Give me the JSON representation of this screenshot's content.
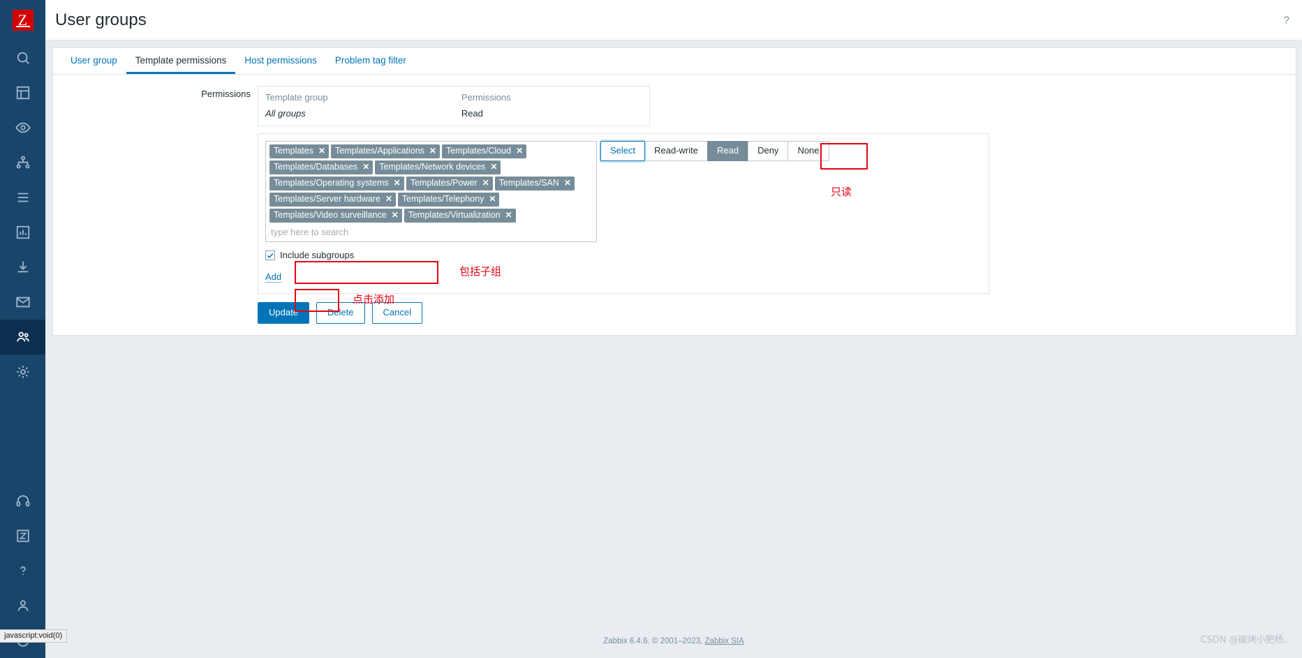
{
  "header": {
    "title": "User groups",
    "help_icon": "?"
  },
  "sidebar": {
    "logo_letter": "Z",
    "items": [
      {
        "name": "search-icon",
        "label": "Search"
      },
      {
        "name": "dashboards-icon",
        "label": "Dashboards"
      },
      {
        "name": "monitoring-icon",
        "label": "Monitoring"
      },
      {
        "name": "services-icon",
        "label": "Services"
      },
      {
        "name": "inventory-icon",
        "label": "Inventory"
      },
      {
        "name": "reports-icon",
        "label": "Reports"
      },
      {
        "name": "data-collection-icon",
        "label": "Data collection"
      },
      {
        "name": "alerts-icon",
        "label": "Alerts"
      },
      {
        "name": "users-icon",
        "label": "Users"
      },
      {
        "name": "administration-icon",
        "label": "Administration"
      }
    ],
    "bottom_items": [
      {
        "name": "support-icon",
        "label": "Support"
      },
      {
        "name": "integrations-icon",
        "label": "Integrations"
      },
      {
        "name": "help-icon",
        "label": "Help"
      },
      {
        "name": "user-settings-icon",
        "label": "User settings"
      },
      {
        "name": "sign-out-icon",
        "label": "Sign out"
      }
    ]
  },
  "tabs": [
    {
      "label": "User group",
      "active": false
    },
    {
      "label": "Template permissions",
      "active": true
    },
    {
      "label": "Host permissions",
      "active": false
    },
    {
      "label": "Problem tag filter",
      "active": false
    }
  ],
  "form": {
    "permissions_label": "Permissions",
    "table": {
      "headers": [
        "Template group",
        "Permissions"
      ],
      "rows": [
        {
          "group": "All groups",
          "permission": "Read"
        }
      ]
    },
    "multiselect": {
      "placeholder": "type here to search",
      "chips": [
        "Templates",
        "Templates/Applications",
        "Templates/Cloud",
        "Templates/Databases",
        "Templates/Network devices",
        "Templates/Operating systems",
        "Templates/Power",
        "Templates/SAN",
        "Templates/Server hardware",
        "Templates/Telephony",
        "Templates/Video surveillance",
        "Templates/Virtualization"
      ],
      "chip_remove_glyph": "✕"
    },
    "permission_buttons": [
      {
        "label": "Select",
        "state": "focused"
      },
      {
        "label": "Read-write",
        "state": "normal"
      },
      {
        "label": "Read",
        "state": "selected"
      },
      {
        "label": "Deny",
        "state": "normal"
      },
      {
        "label": "None",
        "state": "normal"
      }
    ],
    "include_subgroups": {
      "label": "Include subgroups",
      "checked": true
    },
    "add_link": "Add",
    "buttons": {
      "update": "Update",
      "delete": "Delete",
      "cancel": "Cancel"
    }
  },
  "annotations": [
    {
      "name": "annot-read",
      "text": "只读"
    },
    {
      "name": "annot-subgroups",
      "text": "包括子组"
    },
    {
      "name": "annot-add",
      "text": "点击添加"
    }
  ],
  "footer": {
    "copyright_prefix": "Zabbix 6.4.6. © 2001–2023, ",
    "company_link": "Zabbix SIA",
    "watermark": "CSDN @碳烤小肥杨..",
    "status_text": "javascript:void(0)"
  },
  "colors": {
    "brand_blue": "#0275b8",
    "sidebar": "#19456b",
    "chip": "#768d99",
    "annotation_red": "#e60012",
    "logo_red": "#d40000"
  }
}
